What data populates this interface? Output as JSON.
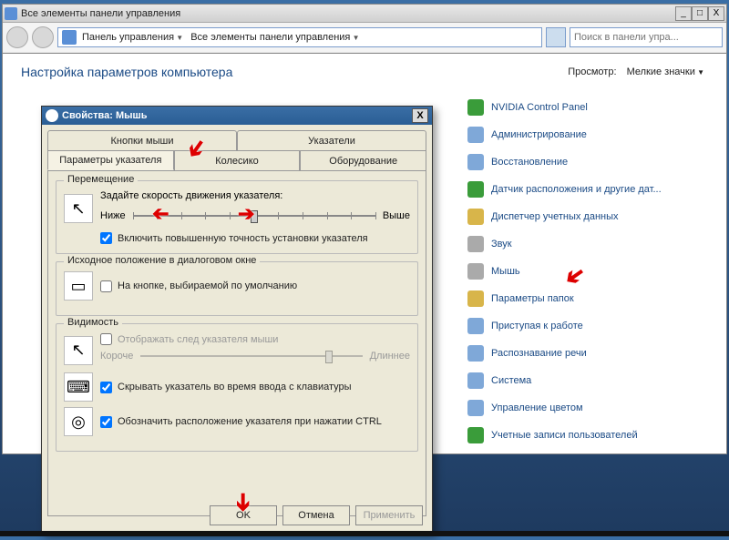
{
  "window": {
    "title": "Все элементы панели управления",
    "breadcrumb": [
      "Панель управления",
      "Все элементы панели управления"
    ],
    "search_placeholder": "Поиск в панели упра..."
  },
  "content": {
    "heading": "Настройка параметров компьютера",
    "view_label": "Просмотр:",
    "view_value": "Мелкие значки",
    "items": [
      "NVIDIA Control Panel",
      "Администрирование",
      "Восстановление",
      "Датчик расположения и другие дат...",
      "Диспетчер учетных данных",
      "Звук",
      "Мышь",
      "Параметры папок",
      "Приступая к работе",
      "Распознавание речи",
      "Система",
      "Управление цветом",
      "Учетные записи пользователей"
    ]
  },
  "dialog": {
    "title": "Свойства: Мышь",
    "tabs_top": [
      "Кнопки мыши",
      "Указатели"
    ],
    "tabs_bottom": [
      "Параметры указателя",
      "Колесико",
      "Оборудование"
    ],
    "group_motion": {
      "title": "Перемещение",
      "speed_label": "Задайте скорость движения указателя:",
      "low": "Ниже",
      "high": "Выше",
      "enhance": "Включить повышенную точность установки указателя"
    },
    "group_snap": {
      "title": "Исходное положение в диалоговом окне",
      "label": "На кнопке, выбираемой по умолчанию"
    },
    "group_vis": {
      "title": "Видимость",
      "trails": "Отображать след указателя мыши",
      "short": "Короче",
      "long": "Длиннее",
      "hide": "Скрывать указатель во время ввода с клавиатуры",
      "ctrl": "Обозначить расположение указателя при нажатии CTRL"
    },
    "buttons": {
      "ok": "OK",
      "cancel": "Отмена",
      "apply": "Применить"
    }
  }
}
